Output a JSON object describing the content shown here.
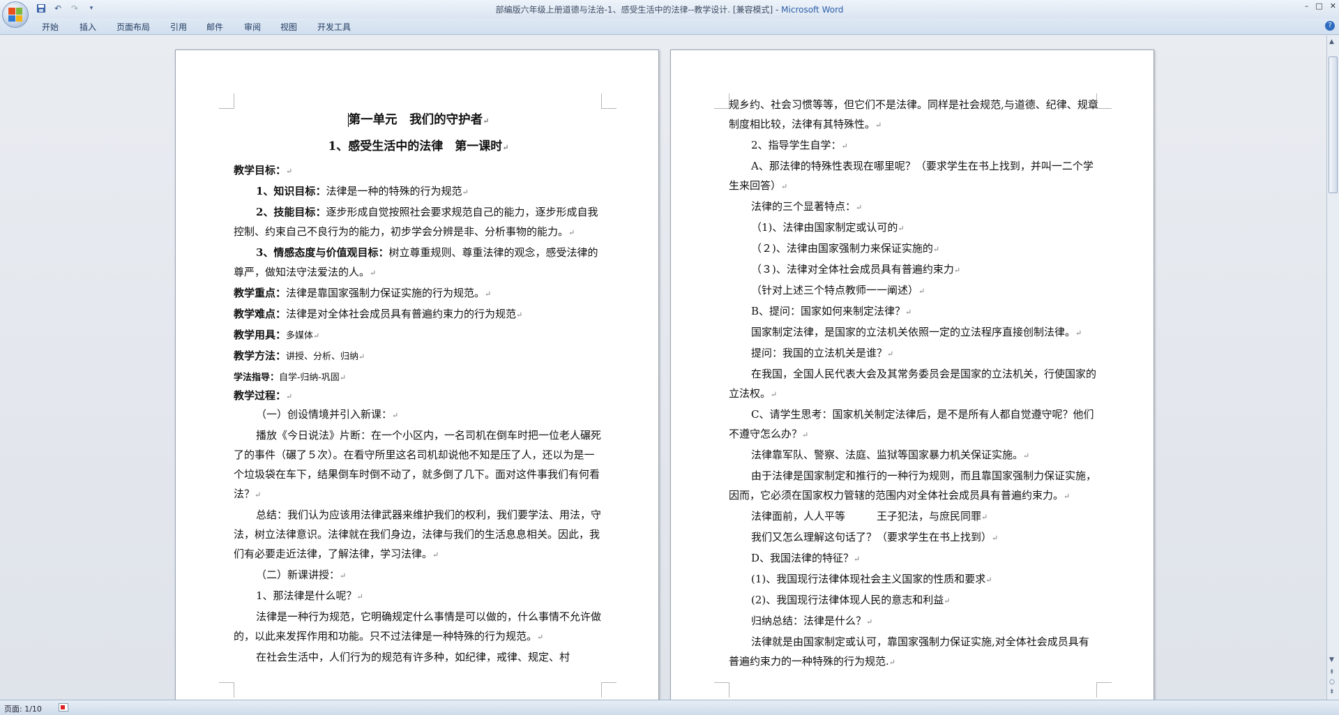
{
  "window": {
    "title": "部编版六年级上册道德与法治-1、感受生活中的法律--教学设计. [兼容模式] - ",
    "app_name": "Microsoft Word"
  },
  "quick_access": {
    "save_icon": "save-icon",
    "undo_icon": "undo-icon",
    "redo_icon": "redo-icon",
    "customize_icon": "dropdown-icon"
  },
  "ribbon": {
    "tabs": [
      "开始",
      "插入",
      "页面布局",
      "引用",
      "邮件",
      "审阅",
      "视图",
      "开发工具"
    ]
  },
  "page_left": {
    "title1": "第一单元　我们的守护者",
    "title2": "1、感受生活中的法律　第一课时",
    "goal_head": "教学目标：",
    "goal1_label": "1、知识目标：",
    "goal1_text": "法律是一种的特殊的行为规范",
    "goal2_label": "2、技能目标：",
    "goal2_text": "逐步形成自觉按照社会要求规范自己的能力，逐步形成自我控制、约束自己不良行为的能力，初步学会分辨是非、分析事物的能力。",
    "goal3_label": "3、情感态度与价值观目标：",
    "goal3_text": "树立尊重规则、尊重法律的观念，感受法律的尊严，做知法守法爱法的人。",
    "key_label": "教学重点：",
    "key_text": "法律是靠国家强制力保证实施的行为规范。",
    "diff_label": "教学难点：",
    "diff_text": "法律是对全体社会成员具有普遍约束力的行为规范",
    "tools_label": "教学用具：",
    "tools_text": "多媒体",
    "method_label": "教学方法：",
    "method_text": "讲授、分析、归纳",
    "guide_label": "学法指导：",
    "guide_text": "自学-归纳-巩固",
    "process_label": "教学过程：",
    "sec1": "（一）创设情境并引入新课：",
    "para1": "播放《今日说法》片断：在一个小区内，一名司机在倒车时把一位老人碾死了的事件（碾了５次）。在看守所里这名司机却说他不知是压了人，还以为是一个垃圾袋在车下，结果倒车时倒不动了，就多倒了几下。面对这件事我们有何看法？",
    "para2": "总结：我们认为应该用法律武器来维护我们的权利，我们要学法、用法，守法，树立法律意识。法律就在我们身边，法律与我们的生活息息相关。因此，我们有必要走近法律，了解法律，学习法律。",
    "sec2": "（二）新课讲授：",
    "q1": "1、那法律是什么呢？",
    "para3": "法律是一种行为规范，它明确规定什么事情是可以做的，什么事情不允许做的，以此来发挥作用和功能。只不过法律是一种特殊的行为规范。",
    "para4": "在社会生活中，人们行为的规范有许多种，如纪律，戒律、规定、村"
  },
  "page_right": {
    "p1": "规乡约、社会习惯等等，但它们不是法律。同样是社会规范,与道德、纪律、规章制度相比较，法律有其特殊性。",
    "p2": "2、指导学生自学：",
    "p3": "A、那法律的特殊性表现在哪里呢？（要求学生在书上找到，并叫一二个学生来回答）",
    "p4": "法律的三个显著特点：",
    "p5": "（1)、法律由国家制定或认可的",
    "p6": "（２)、法律由国家强制力来保证实施的",
    "p7": "（３)、法律对全体社会成员具有普遍约束力",
    "p8": "（针对上述三个特点教师一一阐述）",
    "p9": "B、提问：国家如何来制定法律？",
    "p10": "国家制定法律，是国家的立法机关依照一定的立法程序直接创制法律。",
    "p11": "提问：我国的立法机关是谁？",
    "p12": "在我国，全国人民代表大会及其常务委员会是国家的立法机关，行使国家的立法权。",
    "p13": "C、请学生思考：国家机关制定法律后，是不是所有人都自觉遵守呢？他们不遵守怎么办？",
    "p14": "法律靠军队、警察、法庭、监狱等国家暴力机关保证实施。",
    "p15": "由于法律是国家制定和推行的一种行为规则，而且靠国家强制力保证实施，因而，它必须在国家权力管辖的范围内对全体社会成员具有普遍约束力。",
    "p16": "法律面前，人人平等　　　王子犯法，与庶民同罪",
    "p17": "我们又怎么理解这句话了？（要求学生在书上找到）",
    "p18": "D、我国法律的特征？",
    "p19": "(1)、我国现行法律体现社会主义国家的性质和要求",
    "p20": "(2)、我国现行法律体现人民的意志和利益",
    "p21": "归纳总结：法律是什么？",
    "p22": "法律就是由国家制定或认可，靠国家强制力保证实施,对全体社会成员具有普遍约束力的一种特殊的行为规范."
  },
  "marks": {
    "para": "↵"
  },
  "status": {
    "page": "页面: 1/10"
  }
}
